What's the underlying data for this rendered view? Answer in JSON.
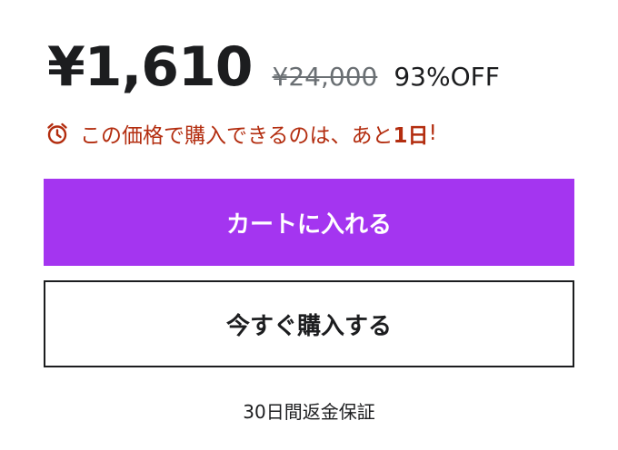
{
  "pricing": {
    "current_price": "¥1,610",
    "original_price": "¥24,000",
    "discount": "93%OFF"
  },
  "urgency": {
    "icon": "alarm-clock-icon",
    "text_prefix": "この価格で購入できるのは、あと",
    "days_left": "1日",
    "text_suffix": "!",
    "color": "#b32d0f"
  },
  "actions": {
    "add_to_cart_label": "カートに入れる",
    "buy_now_label": "今すぐ購入する"
  },
  "guarantee_text": "30日間返金保証",
  "colors": {
    "accent": "#a435f0",
    "text": "#1c1d1f",
    "muted": "#6a6f73"
  }
}
